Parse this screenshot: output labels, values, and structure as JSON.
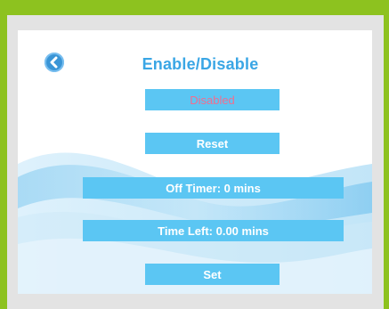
{
  "screen": {
    "title": "Enable/Disable",
    "back_icon": "back-arrow-icon",
    "status_label": "Disabled",
    "reset_label": "Reset",
    "off_timer_label": "Off Timer: 0 mins",
    "time_left_label": "Time Left: 0.00 mins",
    "set_label": "Set"
  },
  "colors": {
    "frame": "#8dc21f",
    "accent": "#5bc6f3",
    "title": "#3aa6e5",
    "status_text": "#f26d8f"
  }
}
